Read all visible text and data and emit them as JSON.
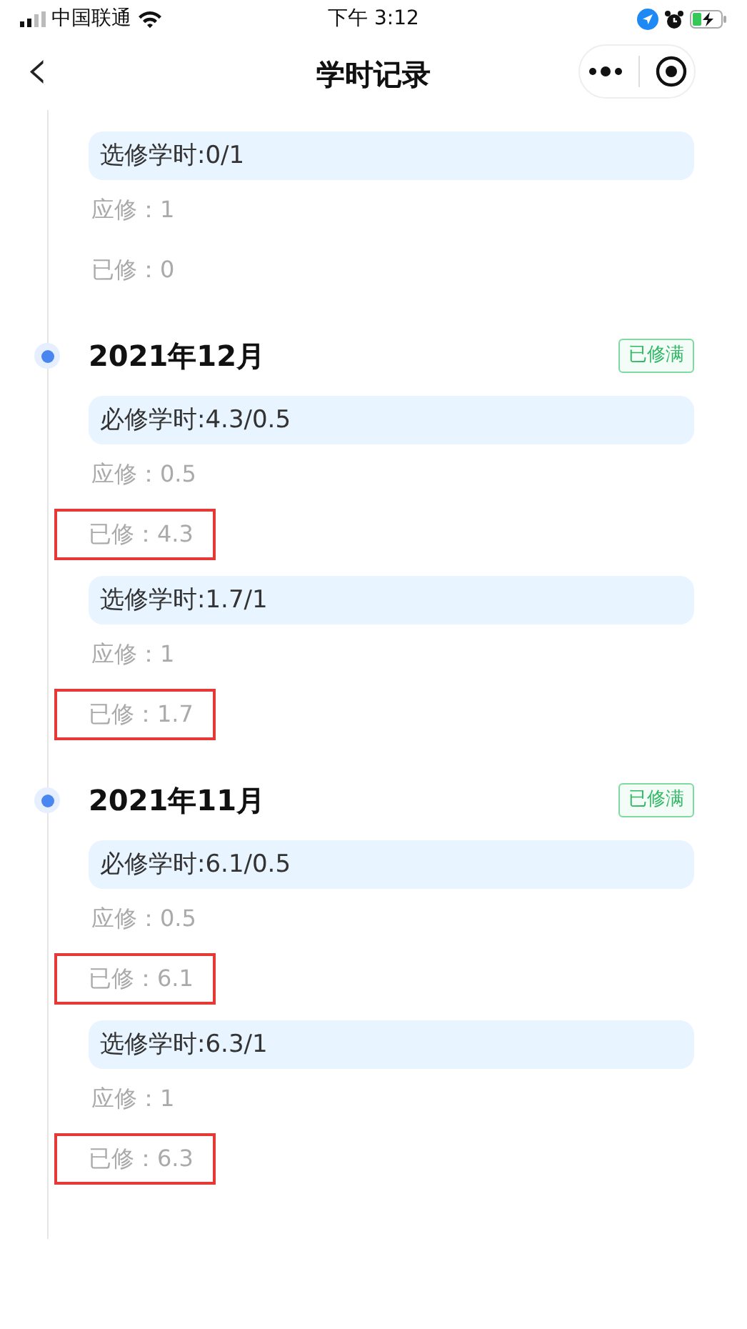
{
  "status_bar": {
    "carrier": "中国联通",
    "time": "下午 3:12"
  },
  "nav": {
    "title": "学时记录",
    "back": "‹"
  },
  "groups": [
    {
      "items": [
        {
          "kind": "category",
          "text": "选修学时:0/1"
        },
        {
          "kind": "line",
          "text": "应修：1",
          "highlighted": false
        },
        {
          "kind": "line",
          "text": "已修：0",
          "highlighted": false
        }
      ]
    },
    {
      "month": "2021年12月",
      "badge": "已修满",
      "items": [
        {
          "kind": "category",
          "text": "必修学时:4.3/0.5"
        },
        {
          "kind": "line",
          "text": "应修：0.5",
          "highlighted": false
        },
        {
          "kind": "line",
          "text": "已修：4.3",
          "highlighted": true
        },
        {
          "kind": "category",
          "text": "选修学时:1.7/1"
        },
        {
          "kind": "line",
          "text": "应修：1",
          "highlighted": false
        },
        {
          "kind": "line",
          "text": "已修：1.7",
          "highlighted": true
        }
      ]
    },
    {
      "month": "2021年11月",
      "badge": "已修满",
      "items": [
        {
          "kind": "category",
          "text": "必修学时:6.1/0.5"
        },
        {
          "kind": "line",
          "text": "应修：0.5",
          "highlighted": false
        },
        {
          "kind": "line",
          "text": "已修：6.1",
          "highlighted": true
        },
        {
          "kind": "category",
          "text": "选修学时:6.3/1"
        },
        {
          "kind": "line",
          "text": "应修：1",
          "highlighted": false
        },
        {
          "kind": "line",
          "text": "已修：6.3",
          "highlighted": true
        }
      ]
    }
  ]
}
